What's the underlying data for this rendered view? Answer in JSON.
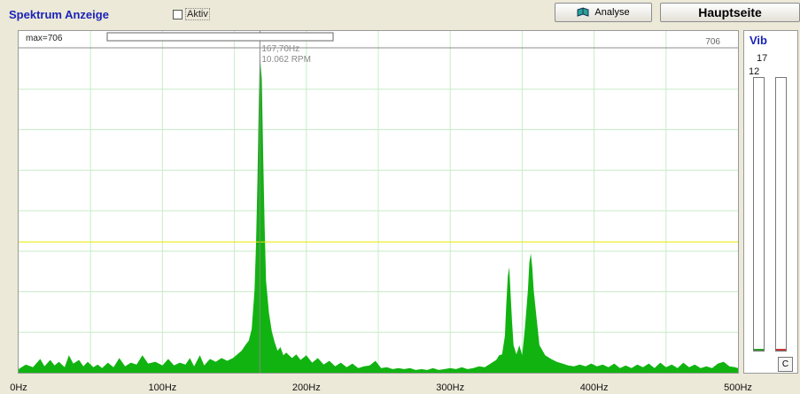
{
  "header": {
    "title": "Spektrum Anzeige",
    "aktiv_label": "Aktiv",
    "aktiv_checked": false,
    "analyse_label": "Analyse",
    "hauptseite_label": "Hauptseite"
  },
  "chart_data": {
    "type": "area",
    "xlim": [
      0,
      500
    ],
    "ylim": [
      0,
      706
    ],
    "max_label": "max=706",
    "max_value_label": "706",
    "cursor": {
      "freq": 167.7,
      "freq_label": "167,70Hz",
      "rpm_label": "10.062 RPM"
    },
    "threshold": 285,
    "x_ticks": [
      0,
      100,
      200,
      300,
      400,
      500
    ],
    "x_tick_labels": [
      "0Hz",
      "100Hz",
      "200Hz",
      "300Hz",
      "400Hz",
      "500Hz"
    ],
    "grid": true,
    "colors": {
      "fill": "#11b311",
      "grid": "#c8ecc8",
      "threshold": "#e8e800",
      "cursor": "#888888"
    },
    "points": [
      [
        0,
        8
      ],
      [
        5,
        18
      ],
      [
        10,
        12
      ],
      [
        15,
        30
      ],
      [
        18,
        14
      ],
      [
        22,
        28
      ],
      [
        25,
        16
      ],
      [
        28,
        24
      ],
      [
        32,
        12
      ],
      [
        35,
        38
      ],
      [
        38,
        20
      ],
      [
        42,
        28
      ],
      [
        45,
        14
      ],
      [
        48,
        24
      ],
      [
        52,
        12
      ],
      [
        55,
        18
      ],
      [
        58,
        10
      ],
      [
        62,
        22
      ],
      [
        66,
        12
      ],
      [
        70,
        32
      ],
      [
        74,
        14
      ],
      [
        78,
        22
      ],
      [
        82,
        18
      ],
      [
        86,
        38
      ],
      [
        90,
        20
      ],
      [
        95,
        24
      ],
      [
        100,
        16
      ],
      [
        104,
        30
      ],
      [
        108,
        16
      ],
      [
        112,
        22
      ],
      [
        116,
        18
      ],
      [
        119,
        32
      ],
      [
        122,
        14
      ],
      [
        126,
        38
      ],
      [
        129,
        16
      ],
      [
        133,
        30
      ],
      [
        137,
        24
      ],
      [
        141,
        32
      ],
      [
        145,
        26
      ],
      [
        149,
        32
      ],
      [
        152,
        40
      ],
      [
        155,
        48
      ],
      [
        158,
        62
      ],
      [
        160,
        70
      ],
      [
        162,
        95
      ],
      [
        164,
        180
      ],
      [
        165,
        280
      ],
      [
        166,
        420
      ],
      [
        167,
        600
      ],
      [
        167.7,
        690
      ],
      [
        169,
        640
      ],
      [
        170,
        470
      ],
      [
        171,
        320
      ],
      [
        172,
        200
      ],
      [
        174,
        130
      ],
      [
        176,
        90
      ],
      [
        178,
        66
      ],
      [
        180,
        48
      ],
      [
        182,
        56
      ],
      [
        184,
        38
      ],
      [
        186,
        44
      ],
      [
        190,
        32
      ],
      [
        193,
        40
      ],
      [
        196,
        28
      ],
      [
        200,
        38
      ],
      [
        204,
        22
      ],
      [
        208,
        32
      ],
      [
        212,
        18
      ],
      [
        216,
        26
      ],
      [
        220,
        14
      ],
      [
        224,
        22
      ],
      [
        228,
        12
      ],
      [
        232,
        20
      ],
      [
        236,
        10
      ],
      [
        240,
        14
      ],
      [
        244,
        16
      ],
      [
        248,
        26
      ],
      [
        252,
        10
      ],
      [
        256,
        12
      ],
      [
        260,
        8
      ],
      [
        264,
        10
      ],
      [
        268,
        8
      ],
      [
        272,
        10
      ],
      [
        276,
        6
      ],
      [
        280,
        8
      ],
      [
        284,
        6
      ],
      [
        288,
        10
      ],
      [
        292,
        6
      ],
      [
        296,
        8
      ],
      [
        300,
        10
      ],
      [
        304,
        8
      ],
      [
        308,
        12
      ],
      [
        312,
        8
      ],
      [
        316,
        10
      ],
      [
        320,
        14
      ],
      [
        324,
        12
      ],
      [
        328,
        20
      ],
      [
        332,
        28
      ],
      [
        334,
        38
      ],
      [
        336,
        40
      ],
      [
        338,
        80
      ],
      [
        339,
        150
      ],
      [
        340,
        210
      ],
      [
        341,
        230
      ],
      [
        342,
        170
      ],
      [
        343,
        110
      ],
      [
        344,
        60
      ],
      [
        346,
        40
      ],
      [
        348,
        60
      ],
      [
        350,
        38
      ],
      [
        352,
        100
      ],
      [
        354,
        180
      ],
      [
        355,
        240
      ],
      [
        356,
        260
      ],
      [
        357,
        230
      ],
      [
        358,
        180
      ],
      [
        360,
        120
      ],
      [
        362,
        60
      ],
      [
        366,
        38
      ],
      [
        370,
        30
      ],
      [
        374,
        24
      ],
      [
        378,
        20
      ],
      [
        382,
        16
      ],
      [
        386,
        14
      ],
      [
        390,
        18
      ],
      [
        394,
        14
      ],
      [
        398,
        20
      ],
      [
        402,
        14
      ],
      [
        406,
        18
      ],
      [
        410,
        12
      ],
      [
        414,
        20
      ],
      [
        418,
        10
      ],
      [
        422,
        16
      ],
      [
        426,
        10
      ],
      [
        430,
        18
      ],
      [
        434,
        12
      ],
      [
        438,
        20
      ],
      [
        442,
        10
      ],
      [
        446,
        22
      ],
      [
        450,
        12
      ],
      [
        454,
        18
      ],
      [
        458,
        10
      ],
      [
        462,
        22
      ],
      [
        466,
        12
      ],
      [
        470,
        18
      ],
      [
        474,
        10
      ],
      [
        478,
        14
      ],
      [
        482,
        10
      ],
      [
        486,
        20
      ],
      [
        490,
        24
      ],
      [
        494,
        14
      ],
      [
        498,
        12
      ],
      [
        500,
        10
      ]
    ]
  },
  "vib": {
    "title": "Vib",
    "value_top": "17",
    "value_second": "12",
    "left_level": 0.0,
    "right_level": 0.0,
    "clear_label": "C"
  }
}
